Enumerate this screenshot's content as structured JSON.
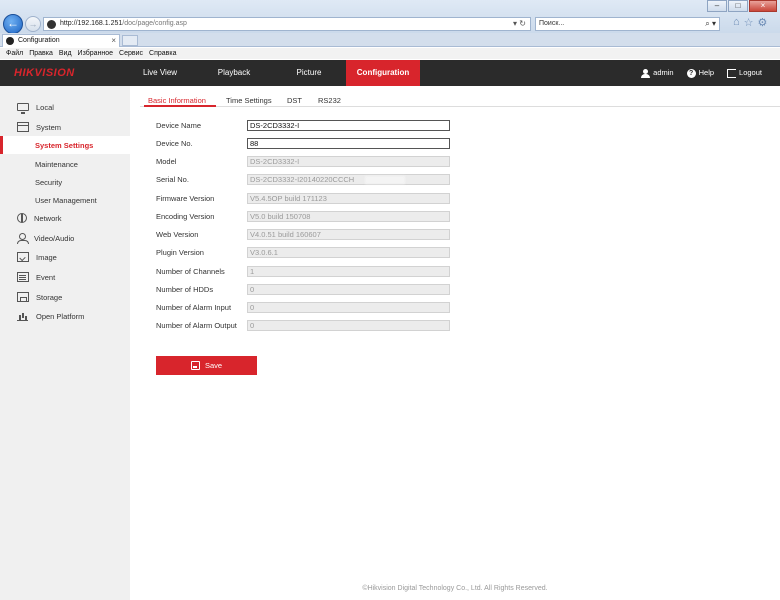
{
  "browser": {
    "address": "http://192.168.1.251/doc/page/config.asp",
    "address_host": "http://192.168.1.251",
    "address_path": "/doc/page/config.asp",
    "address_controls": "▾ ↻",
    "search_placeholder": "Поиск...",
    "search_controls": "⌕ ▾",
    "tab_title": "Configuration",
    "tab_close": "×",
    "window_min": "–",
    "window_max": "□",
    "window_close": "×",
    "menu": [
      "Файл",
      "Правка",
      "Вид",
      "Избранное",
      "Сервис",
      "Справка"
    ]
  },
  "header": {
    "logo": "HIKVISION",
    "nav": [
      "Live View",
      "Playback",
      "Picture",
      "Configuration"
    ],
    "active_nav": "Configuration",
    "user": "admin",
    "help": "Help",
    "logout": "Logout"
  },
  "sidebar": {
    "items": [
      {
        "label": "Local",
        "icon": "monitor-icon"
      },
      {
        "label": "System",
        "icon": "system-icon"
      },
      {
        "label": "System Settings",
        "sub": true,
        "active": true
      },
      {
        "label": "Maintenance",
        "sub": true
      },
      {
        "label": "Security",
        "sub": true
      },
      {
        "label": "User Management",
        "sub": true
      },
      {
        "label": "Network",
        "icon": "network-icon"
      },
      {
        "label": "Video/Audio",
        "icon": "video-audio-icon"
      },
      {
        "label": "Image",
        "icon": "image-icon"
      },
      {
        "label": "Event",
        "icon": "event-icon"
      },
      {
        "label": "Storage",
        "icon": "storage-icon"
      },
      {
        "label": "Open Platform",
        "icon": "open-platform-icon"
      }
    ]
  },
  "subtabs": [
    "Basic Information",
    "Time Settings",
    "DST",
    "RS232"
  ],
  "active_subtab": "Basic Information",
  "form": {
    "device_name": {
      "label": "Device Name",
      "value": "DS-2CD3332-I"
    },
    "device_no": {
      "label": "Device No.",
      "value": "88"
    },
    "model": {
      "label": "Model",
      "value": "DS-2CD3332-I"
    },
    "serial_no": {
      "label": "Serial No.",
      "value": "DS-2CD3332-I20140220CCCH"
    },
    "firmware_version": {
      "label": "Firmware Version",
      "value": "V5.4.5OP build 171123"
    },
    "encoding_version": {
      "label": "Encoding Version",
      "value": "V5.0 build 150708"
    },
    "web_version": {
      "label": "Web Version",
      "value": "V4.0.51 build 160607"
    },
    "plugin_version": {
      "label": "Plugin Version",
      "value": "V3.0.6.1"
    },
    "channels": {
      "label": "Number of Channels",
      "value": "1"
    },
    "hdds": {
      "label": "Number of HDDs",
      "value": "0"
    },
    "alarm_input": {
      "label": "Number of Alarm Input",
      "value": "0"
    },
    "alarm_output": {
      "label": "Number of Alarm Output",
      "value": "0"
    }
  },
  "save_label": "Save",
  "footer": "©Hikvision Digital Technology Co., Ltd. All Rights Reserved."
}
